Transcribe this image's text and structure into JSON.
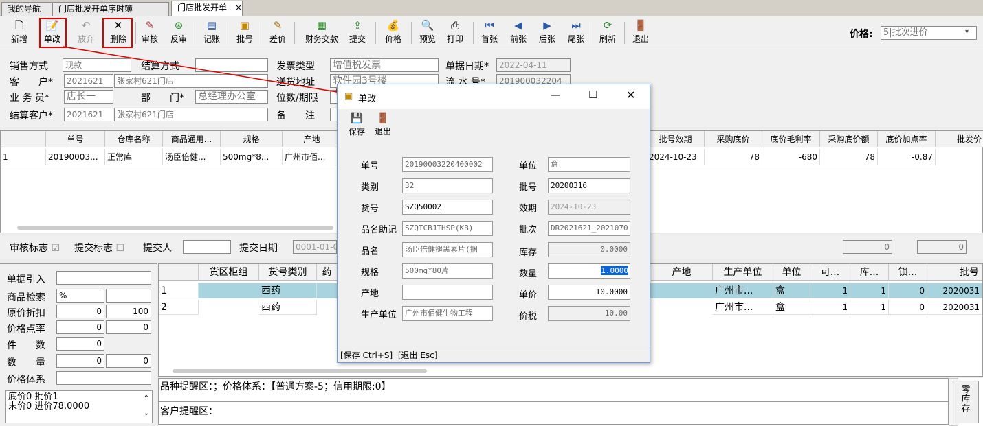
{
  "tabs": [
    {
      "label": "我的导航"
    },
    {
      "label": "门店批发开单序时簿"
    },
    {
      "label": "门店批发开单",
      "close": "×"
    }
  ],
  "toolbar": {
    "buttons": [
      {
        "label": "新增",
        "icon": "new-doc-icon",
        "glyph": "🗋"
      },
      {
        "label": "单改",
        "icon": "edit-doc-icon",
        "glyph": "📝"
      },
      {
        "label": "放弃",
        "icon": "undo-icon",
        "glyph": "↶"
      },
      {
        "label": "删除",
        "icon": "delete-x-icon",
        "glyph": "✕"
      },
      {
        "label": "审核",
        "icon": "audit-icon",
        "glyph": "✎"
      },
      {
        "label": "反审",
        "icon": "reverse-audit-icon",
        "glyph": "⊛"
      },
      {
        "label": "记账",
        "icon": "ledger-icon",
        "glyph": "▤"
      },
      {
        "label": "批号",
        "icon": "batch-icon",
        "glyph": "▣"
      },
      {
        "label": "差价",
        "icon": "price-diff-icon",
        "glyph": "✎"
      },
      {
        "label": "财务交款",
        "icon": "finance-icon",
        "glyph": "▦"
      },
      {
        "label": "提交",
        "icon": "submit-icon",
        "glyph": "⇪"
      },
      {
        "label": "价格",
        "icon": "price-bag-icon",
        "glyph": "💰"
      },
      {
        "label": "预览",
        "icon": "preview-icon",
        "glyph": "🔍"
      },
      {
        "label": "打印",
        "icon": "print-icon",
        "glyph": "⎙"
      },
      {
        "label": "首张",
        "icon": "first-icon",
        "glyph": "⏮"
      },
      {
        "label": "前张",
        "icon": "prev-icon",
        "glyph": "◀"
      },
      {
        "label": "后张",
        "icon": "next-icon",
        "glyph": "▶"
      },
      {
        "label": "尾张",
        "icon": "last-icon",
        "glyph": "⏭"
      },
      {
        "label": "刷新",
        "icon": "refresh-icon",
        "glyph": "⟳"
      },
      {
        "label": "退出",
        "icon": "exit-door-icon",
        "glyph": "🚪"
      }
    ],
    "price_label": "价格:",
    "price_value": "5|批次进价"
  },
  "header": {
    "sale_method_label": "销售方式",
    "sale_method_value": "现款",
    "settle_method_label": "结算方式",
    "settle_method_value": "",
    "invoice_type_label": "发票类型",
    "invoice_type_value": "增值税发票",
    "date_label": "单据日期*",
    "date_value": "2022-04-11",
    "customer_label": "客　　户*",
    "customer_code": "2021621",
    "customer_name": "张家村621门店",
    "delivery_label": "送货地址",
    "delivery_value": "软件园3号楼",
    "serial_label": "流 水 号*",
    "serial_value": "201900032204",
    "salesman_label": "业 务 员*",
    "salesman_value": "店长一",
    "dept_label": "部　　门*",
    "dept_value": "总经理办公室",
    "digits_label": "位数/期限",
    "digits_value": "",
    "settle_customer_label": "结算客户*",
    "settle_customer_code": "2021621",
    "settle_customer_name": "张家村621门店",
    "remark_label": "备　　注",
    "remark_value": ""
  },
  "grid1": {
    "columns": [
      "",
      "单号",
      "仓库名称",
      "商品通用...",
      "规格",
      "产地",
      "批号效期",
      "采购底价",
      "底价毛利率",
      "采购底价额",
      "底价加点率",
      "批发价"
    ],
    "rows": [
      [
        "1",
        "20190003...",
        "正常库",
        "汤臣倍健...",
        "500mg*8...",
        "广州市佰...",
        "2024-10-23",
        "78",
        "-680",
        "78",
        "-0.87",
        ""
      ]
    ]
  },
  "audit": {
    "audit_flag": "审核标志",
    "submit_flag": "提交标志",
    "submitter_label": "提交人",
    "submit_date_label": "提交日期",
    "submit_date_value": "0001-01-0",
    "val1": "0",
    "val2": "0"
  },
  "left_panel": {
    "doc_ref": "单据引入",
    "search": "商品检索",
    "search_value": "%",
    "discount": "原价折扣",
    "discount_a": "0",
    "discount_b": "100",
    "markup": "价格点率",
    "markup_a": "0",
    "markup_b": "0",
    "pieces": "件　　数",
    "pieces_a": "0",
    "qty": "数　　量",
    "qty_a": "0",
    "qty_b": "0",
    "price_sys": "价格体系",
    "memo_line1": "底价0 批价1",
    "memo_line2": "末价0 进价78.0000"
  },
  "grid2": {
    "columns": [
      "",
      "货区柜组",
      "货号类别",
      "药",
      "产地",
      "生产单位",
      "单位",
      "可...",
      "库...",
      "锁...",
      "批号"
    ],
    "rows": [
      {
        "no": "1",
        "cat": "西药",
        "maker": "广州市...",
        "unit": "盒",
        "avail": "1",
        "stock": "1",
        "lock": "0",
        "batch": "2020031"
      },
      {
        "no": "2",
        "cat": "西药",
        "maker": "广州市...",
        "unit": "盒",
        "avail": "1",
        "stock": "1",
        "lock": "0",
        "batch": "2020031"
      }
    ]
  },
  "remind": {
    "product_line": "品种提醒区：；价格体系：【普通方案-5；信用期限:0】",
    "customer_line": "客户提醒区：",
    "side_button": "零库存"
  },
  "dialog": {
    "title": "单改",
    "save_label": "保存",
    "exit_label": "退出",
    "fields_left": [
      {
        "label": "单号",
        "value": "20190003220400002"
      },
      {
        "label": "类别",
        "value": "32"
      },
      {
        "label": "货号",
        "value": "SZQ50002"
      },
      {
        "label": "品名助记",
        "value": "SZQTCBJTHSP(KB)"
      },
      {
        "label": "品名",
        "value": "汤臣倍健褪黑素片(捆"
      },
      {
        "label": "规格",
        "value": "500mg*80片"
      },
      {
        "label": "产地",
        "value": ""
      },
      {
        "label": "生产单位",
        "value": "广州市佰健生物工程"
      }
    ],
    "fields_right": [
      {
        "label": "单位",
        "value": "盒"
      },
      {
        "label": "批号",
        "value": "20200316"
      },
      {
        "label": "效期",
        "value": "2024-10-23"
      },
      {
        "label": "批次",
        "value": "DR2021621_2021070"
      },
      {
        "label": "库存",
        "value": "0.0000"
      },
      {
        "label": "数量",
        "value": "1.0000"
      },
      {
        "label": "单价",
        "value": "10.0000"
      },
      {
        "label": "价税",
        "value": "10.00"
      }
    ],
    "status": "[保存 Ctrl+S]  [退出 Esc]"
  }
}
